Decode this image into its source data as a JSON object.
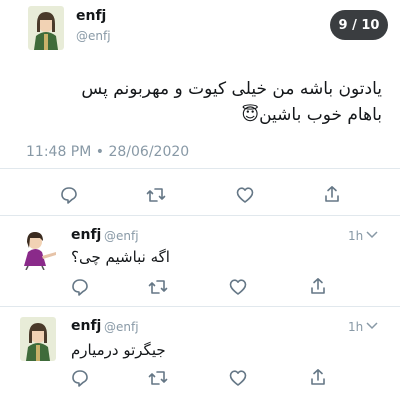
{
  "counter": "9 / 10",
  "main_tweet": {
    "name": "enfj",
    "handle": "@enfj",
    "text_line1": "یادتون باشه من خیلی کیوت و مهربونم پس",
    "text_line2": "باهام خوب باشین",
    "emoji": "😇",
    "meta": "11:48 PM • 28/06/2020"
  },
  "replies": [
    {
      "name": "enfj",
      "handle": "@enfj",
      "time": "1h",
      "text": "اگه نباشیم چی؟"
    },
    {
      "name": "enfj",
      "handle": "@enfj",
      "time": "1h",
      "text": "جیگرتو درمیارم"
    }
  ],
  "icons": {
    "reply": "reply-icon",
    "retweet": "retweet-icon",
    "like": "like-icon",
    "share": "share-icon",
    "chevron": "chevron-down-icon"
  },
  "colors": {
    "text": "#14171a",
    "muted": "#8899a6",
    "separator": "#e1e8ed",
    "counter_bg": "#3a3d40"
  }
}
